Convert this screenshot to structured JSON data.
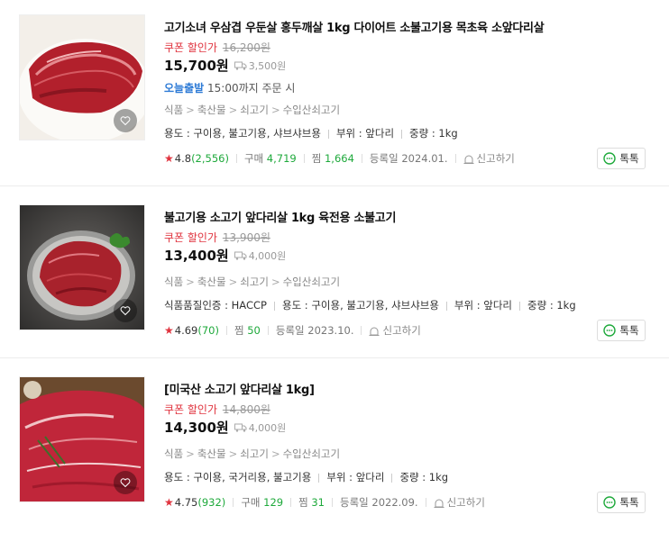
{
  "products": [
    {
      "title": "고기소녀 우삼겹 우둔살 홍두깨살 1kg 다이어트 소불고기용 목초육 소앞다리살",
      "coupon_label": "쿠폰 할인가",
      "original_price": "16,200원",
      "price": "15,700원",
      "shipping": "3,500원",
      "today_label": "오늘출발",
      "today_text": "15:00까지 주문 시",
      "categories": [
        "식품",
        "축산물",
        "쇠고기",
        "수입산쇠고기"
      ],
      "specs": [
        "용도 : 구이용, 불고기용, 샤브샤브용",
        "부위 : 앞다리",
        "중량 : 1kg"
      ],
      "rating": "4.8",
      "reviews": "(2,556)",
      "purchase_label": "구매",
      "purchase_count": "4,719",
      "wish_label": "찜",
      "wish_count": "1,664",
      "registered": "등록일 2024.01.",
      "report_label": "신고하기",
      "talk_label": "톡톡"
    },
    {
      "title": "불고기용 소고기 앞다리살 1kg 육전용 소불고기",
      "coupon_label": "쿠폰 할인가",
      "original_price": "13,900원",
      "price": "13,400원",
      "shipping": "4,000원",
      "categories": [
        "식품",
        "축산물",
        "쇠고기",
        "수입산쇠고기"
      ],
      "specs": [
        "식품품질인증 : HACCP",
        "용도 : 구이용, 불고기용, 샤브샤브용",
        "부위 : 앞다리",
        "중량 : 1kg"
      ],
      "rating": "4.69",
      "reviews": "(70)",
      "wish_label": "찜",
      "wish_count": "50",
      "registered": "등록일 2023.10.",
      "report_label": "신고하기",
      "talk_label": "톡톡"
    },
    {
      "title": "[미국산 소고기 앞다리살 1kg]",
      "coupon_label": "쿠폰 할인가",
      "original_price": "14,800원",
      "price": "14,300원",
      "shipping": "4,000원",
      "categories": [
        "식품",
        "축산물",
        "쇠고기",
        "수입산쇠고기"
      ],
      "specs": [
        "용도 : 구이용, 국거리용, 불고기용",
        "부위 : 앞다리",
        "중량 : 1kg"
      ],
      "rating": "4.75",
      "reviews": "(932)",
      "purchase_label": "구매",
      "purchase_count": "129",
      "wish_label": "찜",
      "wish_count": "31",
      "registered": "등록일 2022.09.",
      "report_label": "신고하기",
      "talk_label": "톡톡"
    }
  ],
  "colors": {
    "coupon": "#e0343f",
    "today": "#2e7bd6",
    "count_green": "#1ea93b",
    "star": "#e0343f"
  },
  "icons": [
    "heart-icon",
    "truck-icon",
    "star-icon",
    "siren-icon",
    "talk-icon"
  ]
}
